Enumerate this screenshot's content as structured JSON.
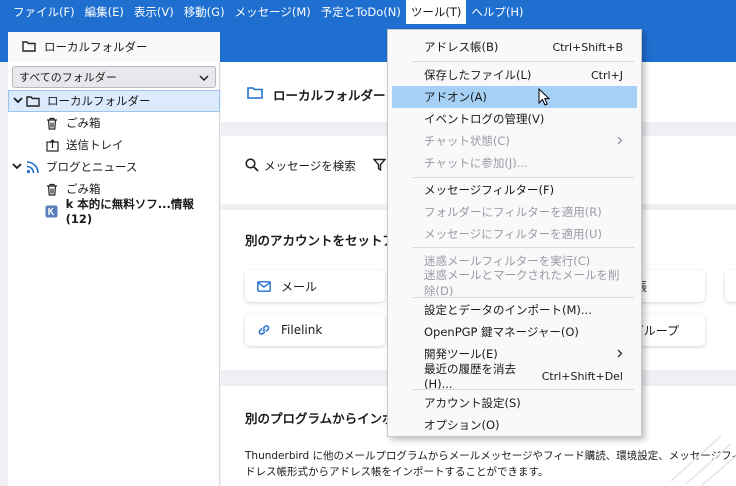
{
  "menubar": {
    "items": [
      {
        "label": "ファイル(F)"
      },
      {
        "label": "編集(E)"
      },
      {
        "label": "表示(V)"
      },
      {
        "label": "移動(G)"
      },
      {
        "label": "メッセージ(M)"
      },
      {
        "label": "予定とToDo(N)"
      },
      {
        "label": "ツール(T)"
      },
      {
        "label": "ヘルプ(H)"
      }
    ]
  },
  "tab": {
    "label": "ローカルフォルダー"
  },
  "sidebar": {
    "folder_select": "すべてのフォルダー",
    "items": [
      {
        "label": "ローカルフォルダー"
      },
      {
        "label": "ごみ箱"
      },
      {
        "label": "送信トレイ"
      },
      {
        "label": "ブログとニュース"
      },
      {
        "label": "ごみ箱"
      },
      {
        "label": "k 本的に無料ソフ...情報 (12)"
      }
    ]
  },
  "main": {
    "header": "ローカルフォルダー",
    "search_label": "メッセージを検索",
    "setup_title": "別のアカウントをセットアッ",
    "cards": [
      {
        "label": "メール"
      },
      {
        "label": "Filelink"
      },
      {
        "label": "帳"
      },
      {
        "label": "グループ"
      }
    ],
    "import_title": "別のプログラムからインポー",
    "import_text_1": "Thunderbird に他のメールプログラムからメールメッセージやフィード購読、環境設定、メッセージフィルターを、",
    "import_text_2": "ドレス帳形式からアドレス帳をインポートすることができます。"
  },
  "tools_menu": {
    "items": [
      {
        "label": "アドレス帳(B)",
        "shortcut": "Ctrl+Shift+B"
      },
      {
        "label": "保存したファイル(L)",
        "shortcut": "Ctrl+J"
      },
      {
        "label": "アドオン(A)",
        "shortcut": ""
      },
      {
        "label": "イベントログの管理(V)",
        "shortcut": ""
      },
      {
        "label": "チャット状態(C)",
        "shortcut": ""
      },
      {
        "label": "チャットに参加(J)...",
        "shortcut": ""
      },
      {
        "label": "メッセージフィルター(F)",
        "shortcut": ""
      },
      {
        "label": "フォルダーにフィルターを適用(R)",
        "shortcut": ""
      },
      {
        "label": "メッセージにフィルターを適用(U)",
        "shortcut": ""
      },
      {
        "label": "迷惑メールフィルターを実行(C)",
        "shortcut": ""
      },
      {
        "label": "迷惑メールとマークされたメールを削除(D)",
        "shortcut": ""
      },
      {
        "label": "設定とデータのインポート(M)...",
        "shortcut": ""
      },
      {
        "label": "OpenPGP 鍵マネージャー(O)",
        "shortcut": ""
      },
      {
        "label": "開発ツール(E)",
        "shortcut": ""
      },
      {
        "label": "最近の履歴を消去(H)...",
        "shortcut": "Ctrl+Shift+Del"
      },
      {
        "label": "アカウント設定(S)",
        "shortcut": ""
      },
      {
        "label": "オプション(O)",
        "shortcut": ""
      }
    ]
  },
  "colors": {
    "accent": "#1f6fd1",
    "hover": "#a6d0f5",
    "selection": "#dbeafd"
  }
}
